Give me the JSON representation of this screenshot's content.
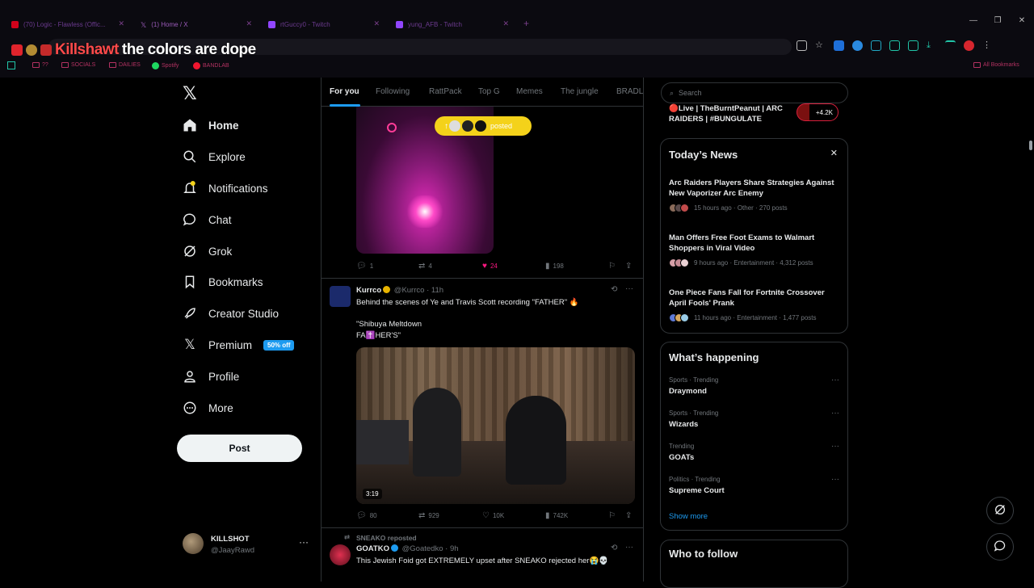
{
  "browser": {
    "tabs": [
      {
        "title": "(70) Logic - Flawless (Offic...",
        "fav_color": "#d0021b"
      },
      {
        "title": "(1) Home / X",
        "fav_color": "#9a5ab8"
      },
      {
        "title": "rtGuccy0 - Twitch",
        "fav_color": "#9146ff"
      },
      {
        "title": "yung_AFB - Twitch",
        "fav_color": "#9146ff"
      }
    ],
    "overlay_caption_name": "Killshawt",
    "overlay_caption_text": "the colors are dope",
    "bookmarks": [
      "??",
      "SOCIALS",
      "DAILIES",
      "Spotify",
      "BANDLAB"
    ],
    "all_bookmarks": "All Bookmarks",
    "window_controls": [
      "—",
      "❐",
      "✕"
    ]
  },
  "nav": {
    "items": [
      {
        "label": "Home",
        "icon": "home-icon"
      },
      {
        "label": "Explore",
        "icon": "search-icon"
      },
      {
        "label": "Notifications",
        "icon": "bell-icon"
      },
      {
        "label": "Chat",
        "icon": "chat-icon"
      },
      {
        "label": "Grok",
        "icon": "grok-icon"
      },
      {
        "label": "Bookmarks",
        "icon": "bookmark-icon"
      },
      {
        "label": "Creator Studio",
        "icon": "rocket-icon"
      },
      {
        "label": "Premium",
        "icon": "x-icon"
      },
      {
        "label": "Profile",
        "icon": "person-icon"
      },
      {
        "label": "More",
        "icon": "more-circle-icon"
      }
    ],
    "premium_badge": "50% off",
    "post_label": "Post",
    "account": {
      "name": "KILLSHOT",
      "handle": "@JaayRawd"
    }
  },
  "feed": {
    "tabs": [
      "For you",
      "Following",
      "RattPack",
      "Top G",
      "Memes",
      "The jungle",
      "BRADLE"
    ],
    "posted_pill": "posted",
    "post1_actions": {
      "replies": "1",
      "reposts": "4",
      "likes": "24",
      "views": "198"
    },
    "post2": {
      "name": "Kurrco",
      "handle": "@Kurrco",
      "time": "11h",
      "text": "Behind the scenes of Ye and Travis Scott recording \"FATHER\" 🔥\n\n\"Shibuya Meltdown\nFA✝️HER'S\"",
      "video_duration": "3:19",
      "replies": "80",
      "reposts": "929",
      "likes": "10K",
      "views": "742K"
    },
    "post3": {
      "repost_by": "SNEAKO reposted",
      "name": "GOATKO",
      "handle": "@Goatedko",
      "time": "9h",
      "text": "This Jewish Foid got EXTREMELY upset after SNEAKO rejected her😭💀"
    }
  },
  "sidebar": {
    "search_placeholder": "Search",
    "live_title": "🔴Live | TheBurntPeanut | ARC RAIDERS | #BUNGULATE",
    "live_count": "+4.2K",
    "news_title": "Today’s News",
    "news": [
      {
        "title": "Arc Raiders Players Share Strategies Against New Vaporizer Arc Enemy",
        "meta": "15 hours ago · Other · 270 posts"
      },
      {
        "title": "Man Offers Free Foot Exams to Walmart Shoppers in Viral Video",
        "meta": "9 hours ago · Entertainment · 4,312 posts"
      },
      {
        "title": "One Piece Fans Fall for Fortnite Crossover April Fools' Prank",
        "meta": "11 hours ago · Entertainment · 1,477 posts"
      }
    ],
    "happening_title": "What’s happening",
    "trends": [
      {
        "category": "Sports · Trending",
        "name": "Draymond"
      },
      {
        "category": "Sports · Trending",
        "name": "Wizards"
      },
      {
        "category": "Trending",
        "name": "GOATs"
      },
      {
        "category": "Politics · Trending",
        "name": "Supreme Court"
      }
    ],
    "show_more": "Show more",
    "who_to_follow": "Who to follow"
  },
  "colors": {
    "accent": "#1d9bf0",
    "like": "#f91880",
    "posted_pill": "#f4d21a"
  }
}
